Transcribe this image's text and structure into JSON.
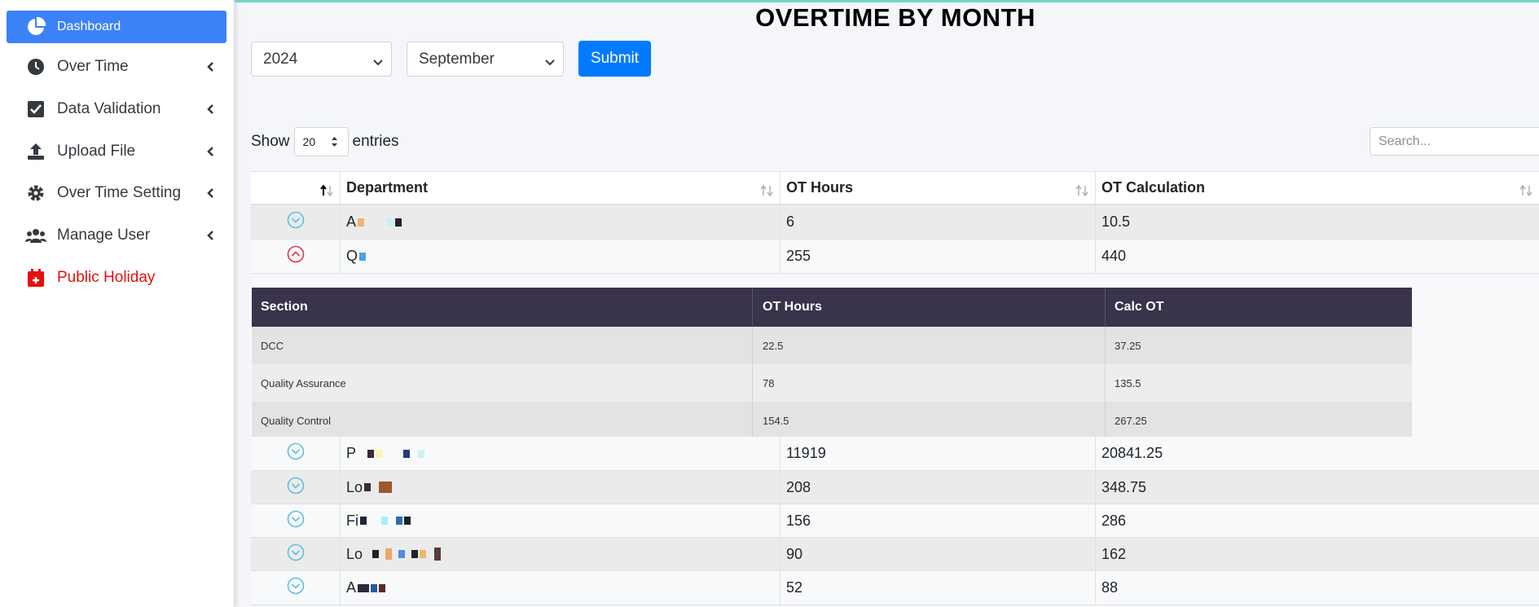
{
  "sidebar": {
    "items": [
      {
        "label": "Dashboard",
        "icon": "pie-chart-icon"
      },
      {
        "label": "Over Time",
        "icon": "clock-icon"
      },
      {
        "label": "Data Validation",
        "icon": "check-square-icon"
      },
      {
        "label": "Upload File",
        "icon": "upload-icon"
      },
      {
        "label": "Over Time Setting",
        "icon": "gear-icon"
      },
      {
        "label": "Manage User",
        "icon": "users-icon"
      },
      {
        "label": "Public Holiday",
        "icon": "calendar-plus-icon"
      }
    ]
  },
  "page": {
    "title": "OVERTIME BY MONTH"
  },
  "filters": {
    "year": "2024",
    "month": "September",
    "submit_label": "Submit"
  },
  "table_controls": {
    "show_label": "Show",
    "page_length": "20",
    "entries_label": "entries",
    "search_placeholder": "Search..."
  },
  "table": {
    "headers": [
      "Department",
      "OT Hours",
      "OT Calculation"
    ],
    "rows_top": [
      {
        "department": "A",
        "ot_hours": "6",
        "ot_calc": "10.5",
        "expanded": false
      },
      {
        "department": "Q",
        "ot_hours": "255",
        "ot_calc": "440",
        "expanded": true
      }
    ],
    "subtable": {
      "headers": [
        "Section",
        "OT Hours",
        "Calc OT"
      ],
      "rows": [
        {
          "section": "DCC",
          "ot_hours": "22.5",
          "calc_ot": "37.25"
        },
        {
          "section": "Quality Assurance",
          "ot_hours": "78",
          "calc_ot": "135.5"
        },
        {
          "section": "Quality Control",
          "ot_hours": "154.5",
          "calc_ot": "267.25"
        }
      ]
    },
    "rows_bottom": [
      {
        "department": "P",
        "ot_hours": "11919",
        "ot_calc": "20841.25"
      },
      {
        "department": "Lo",
        "ot_hours": "208",
        "ot_calc": "348.75"
      },
      {
        "department": "Fi",
        "ot_hours": "156",
        "ot_calc": "286"
      },
      {
        "department": "Lo",
        "ot_hours": "90",
        "ot_calc": "162"
      },
      {
        "department": "A",
        "ot_hours": "52",
        "ot_calc": "88"
      }
    ]
  },
  "colors": {
    "accent": "#3b82f6",
    "submit": "#007bff",
    "holiday": "#e3120b",
    "subtable_header": "#3a334c",
    "expand_icon": "#5bc0de",
    "collapse_icon": "#dc3545"
  }
}
